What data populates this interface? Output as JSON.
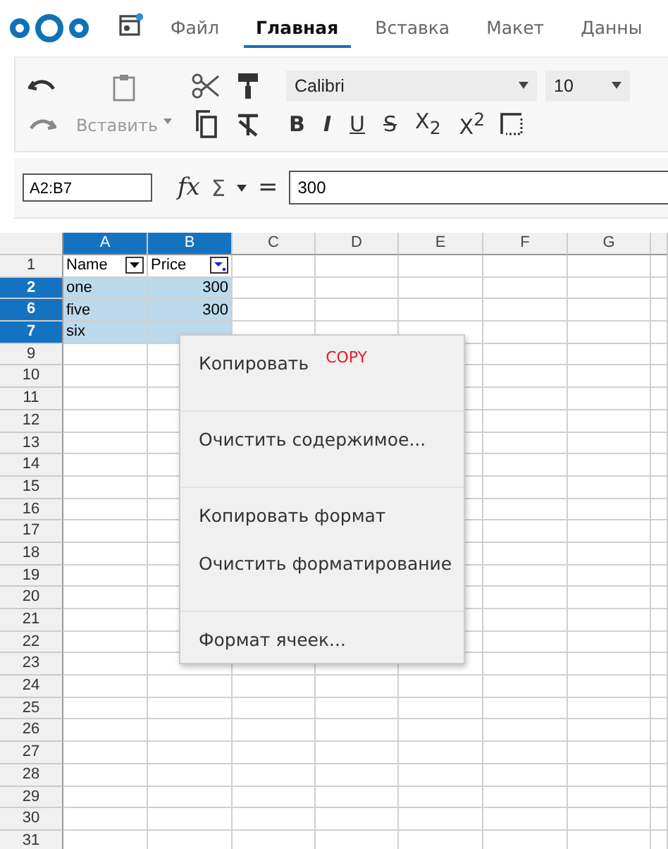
{
  "menubar": {
    "tabs": [
      {
        "label": "Файл",
        "selected": false
      },
      {
        "label": "Главная",
        "selected": true
      },
      {
        "label": "Вставка",
        "selected": false
      },
      {
        "label": "Макет",
        "selected": false
      },
      {
        "label": "Данны",
        "selected": false
      }
    ]
  },
  "ribbon": {
    "paste_label": "Вставить",
    "font": "Calibri",
    "size": "10",
    "format_buttons": [
      {
        "kind": "bold",
        "label": "B"
      },
      {
        "kind": "italic",
        "label": "I"
      },
      {
        "kind": "underline",
        "label": "U"
      },
      {
        "kind": "strike",
        "label": "S"
      },
      {
        "kind": "plain",
        "label": "X$_{2}$"
      },
      {
        "kind": "plain",
        "label": "X$^{2}$"
      }
    ]
  },
  "formula_bar": {
    "name_box": "A2:B7",
    "function_label": "fx",
    "sum_label": "Σ",
    "equals": "=",
    "value": "300"
  },
  "sheet": {
    "columns": [
      {
        "label": "A",
        "selected": true
      },
      {
        "label": "B",
        "selected": true
      },
      {
        "label": "C",
        "selected": false
      },
      {
        "label": "D",
        "selected": false
      },
      {
        "label": "E",
        "selected": false
      },
      {
        "label": "F",
        "selected": false
      },
      {
        "label": "G",
        "selected": false
      }
    ],
    "rows": [
      {
        "label": "1",
        "selected": false,
        "cells": [
          {
            "text": "Name",
            "kind": "header",
            "filtered": false,
            "selected": false
          },
          {
            "text": "Price",
            "kind": "header",
            "filtered": true,
            "selected": false
          }
        ]
      },
      {
        "label": "2",
        "selected": true,
        "cells": [
          {
            "text": "one",
            "kind": "text",
            "selected": true
          },
          {
            "text": "300",
            "kind": "number",
            "selected": true
          }
        ]
      },
      {
        "label": "6",
        "selected": true,
        "cells": [
          {
            "text": "five",
            "kind": "text",
            "selected": true
          },
          {
            "text": "300",
            "kind": "number",
            "selected": true
          }
        ]
      },
      {
        "label": "7",
        "selected": true,
        "cells": [
          {
            "text": "six",
            "kind": "text",
            "selected": true
          },
          {
            "kind": "number",
            "selected": true
          }
        ]
      },
      {
        "label": "9",
        "selected": false
      },
      {
        "label": "10",
        "selected": false
      },
      {
        "label": "11",
        "selected": false
      },
      {
        "label": "12",
        "selected": false
      },
      {
        "label": "13",
        "selected": false
      },
      {
        "label": "14",
        "selected": false
      },
      {
        "label": "15",
        "selected": false
      },
      {
        "label": "16",
        "selected": false
      },
      {
        "label": "17",
        "selected": false
      },
      {
        "label": "18",
        "selected": false
      },
      {
        "label": "19",
        "selected": false
      },
      {
        "label": "20",
        "selected": false
      },
      {
        "label": "21",
        "selected": false
      },
      {
        "label": "22",
        "selected": false
      },
      {
        "label": "23",
        "selected": false
      },
      {
        "label": "24",
        "selected": false
      },
      {
        "label": "25",
        "selected": false
      },
      {
        "label": "26",
        "selected": false
      },
      {
        "label": "27",
        "selected": false
      },
      {
        "label": "28",
        "selected": false
      },
      {
        "label": "29",
        "selected": false
      },
      {
        "label": "30",
        "selected": false
      },
      {
        "label": "31",
        "selected": false
      }
    ]
  },
  "context_menu": {
    "groups": [
      [
        {
          "label": "Копировать",
          "note": "COPY"
        }
      ],
      [
        {
          "label": "Очистить содержимое..."
        }
      ],
      [
        {
          "label": "Копировать формат"
        },
        {
          "label": "Очистить форматирование"
        }
      ],
      [
        {
          "label": "Формат ячеек..."
        }
      ]
    ]
  }
}
